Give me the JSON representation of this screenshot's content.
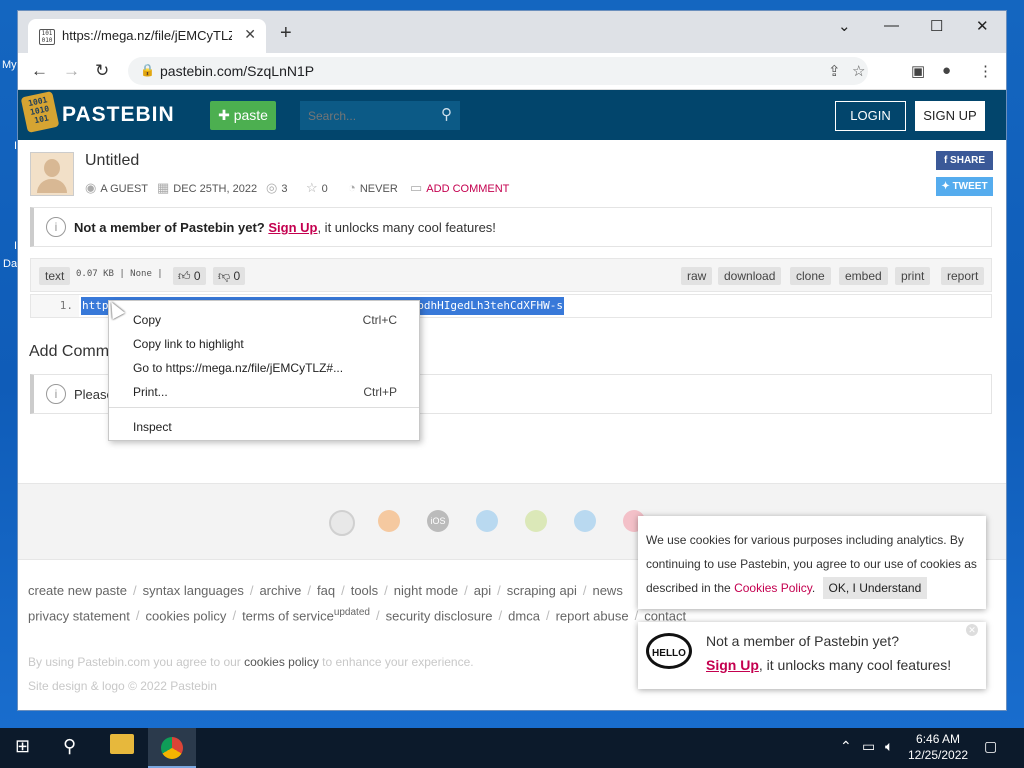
{
  "desktop": {
    "labels": [
      "My",
      "I",
      "Da"
    ]
  },
  "browser": {
    "tab_title": "https://mega.nz/file/jEMCyTLZ#8",
    "tab_close": "✕",
    "new_tab": "+",
    "url": "pastebin.com/SzqLnN1P",
    "window_controls": [
      "⌄",
      "—",
      "☐",
      "✕"
    ]
  },
  "pastebin": {
    "brand": "PASTEBIN",
    "paste_button": "paste",
    "search_placeholder": "Search...",
    "login": "LOGIN",
    "signup": "SIGN UP"
  },
  "paste": {
    "title": "Untitled",
    "author": "A GUEST",
    "date": "DEC 25TH, 2022",
    "views": "3",
    "stars": "0",
    "expiry": "NEVER",
    "add_comment": "ADD COMMENT",
    "share": "SHARE",
    "tweet": "TWEET"
  },
  "notice": {
    "bold": "Not a member of Pastebin yet?",
    "signup": "Sign Up",
    "rest": ", it unlocks many cool features!"
  },
  "toolbar": {
    "syntax": "text",
    "size_info": "0.07 KB | None |",
    "likes": "0",
    "dislikes": "0",
    "actions": [
      "raw",
      "download",
      "clone",
      "embed",
      "print",
      "report"
    ]
  },
  "code": {
    "line_number": "1.",
    "selected_start": "http",
    "selected_end": "bdhHIgedLh3tehCdXFHW-s"
  },
  "comments": {
    "heading": "Add Comm",
    "notice_text": "Please"
  },
  "context_menu": {
    "items": [
      {
        "label": "Copy",
        "shortcut": "Ctrl+C"
      },
      {
        "label": "Copy link to highlight",
        "shortcut": ""
      },
      {
        "label": "Go to https://mega.nz/file/jEMCyTLZ#...",
        "shortcut": ""
      },
      {
        "label": "Print...",
        "shortcut": "Ctrl+P"
      },
      {
        "label": "Inspect",
        "shortcut": ""
      }
    ]
  },
  "footer": {
    "row1": [
      "create new paste",
      "syntax languages",
      "archive",
      "faq",
      "tools",
      "night mode",
      "api",
      "scraping api",
      "news"
    ],
    "row2": [
      "privacy statement",
      "cookies policy",
      "terms of service",
      "security disclosure",
      "dmca",
      "report abuse",
      "contact"
    ],
    "updated_sup": "updated",
    "fine1_a": "By using Pastebin.com you agree to our ",
    "fine1_link": "cookies policy",
    "fine1_b": " to enhance your experience.",
    "fine2": "Site design & logo © 2022 Pastebin"
  },
  "cookie_banner": {
    "text": "We use cookies for various purposes including analytics. By continuing to use Pastebin, you agree to our use of cookies as described in the ",
    "policy_link": "Cookies Policy",
    "ok_button": "OK, I Understand"
  },
  "signup_popup": {
    "bubble": "HELLO",
    "line1": "Not a member of Pastebin yet?",
    "signup": "Sign Up",
    "rest": ", it unlocks many cool features!"
  },
  "taskbar": {
    "time": "6:46 AM",
    "date": "12/25/2022"
  },
  "colors": {
    "pastebin_header": "#02456c",
    "paste_button": "#4caf50",
    "accent_link": "#c4004f",
    "selection": "#3879d9",
    "taskbar": "#0c1a2b"
  }
}
